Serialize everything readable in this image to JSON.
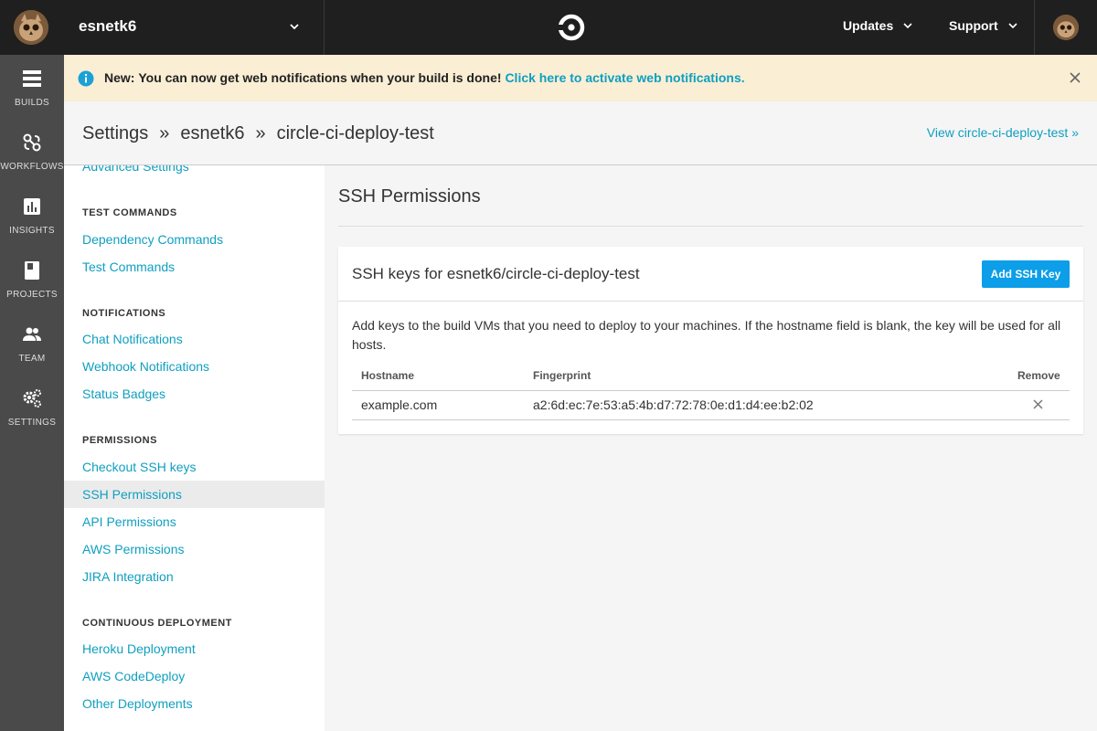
{
  "topbar": {
    "org_name": "esnetk6",
    "nav": {
      "updates": "Updates",
      "support": "Support"
    }
  },
  "rail": {
    "items": [
      {
        "label": "BUILDS",
        "icon": "builds-icon"
      },
      {
        "label": "WORKFLOWS",
        "icon": "workflows-icon"
      },
      {
        "label": "INSIGHTS",
        "icon": "insights-icon"
      },
      {
        "label": "PROJECTS",
        "icon": "projects-icon"
      },
      {
        "label": "TEAM",
        "icon": "team-icon"
      },
      {
        "label": "SETTINGS",
        "icon": "settings-icon"
      }
    ]
  },
  "banner": {
    "bold_prefix": "New:",
    "message": "You can now get web notifications when your build is done!",
    "link": "Click here to activate web notifications."
  },
  "header": {
    "breadcrumb": [
      "Settings",
      "»",
      "esnetk6",
      "»",
      "circle-ci-deploy-test"
    ],
    "view_link": "View circle-ci-deploy-test »"
  },
  "sidebar": {
    "partial_link": "Advanced Settings",
    "sections": [
      {
        "heading": "TEST COMMANDS",
        "links": [
          "Dependency Commands",
          "Test Commands"
        ]
      },
      {
        "heading": "NOTIFICATIONS",
        "links": [
          "Chat Notifications",
          "Webhook Notifications",
          "Status Badges"
        ]
      },
      {
        "heading": "PERMISSIONS",
        "links": [
          "Checkout SSH keys",
          "SSH Permissions",
          "API Permissions",
          "AWS Permissions",
          "JIRA Integration"
        ]
      },
      {
        "heading": "CONTINUOUS DEPLOYMENT",
        "links": [
          "Heroku Deployment",
          "AWS CodeDeploy",
          "Other Deployments"
        ]
      }
    ],
    "active": "SSH Permissions"
  },
  "main": {
    "title": "SSH Permissions",
    "card": {
      "title": "SSH keys for esnetk6/circle-ci-deploy-test",
      "add_button": "Add SSH Key",
      "description": "Add keys to the build VMs that you need to deploy to your machines. If the hostname field is blank, the key will be used for all hosts.",
      "columns": [
        "Hostname",
        "Fingerprint",
        "Remove"
      ],
      "rows": [
        {
          "hostname": "example.com",
          "fingerprint": "a2:6d:ec:7e:53:a5:4b:d7:72:78:0e:d1:d4:ee:b2:02"
        }
      ]
    }
  },
  "colors": {
    "accent": "#0f9fc0",
    "button": "#0c9ee8",
    "topbar": "#1f1f1f",
    "rail": "#4a4a4a",
    "banner": "#faeed4"
  }
}
